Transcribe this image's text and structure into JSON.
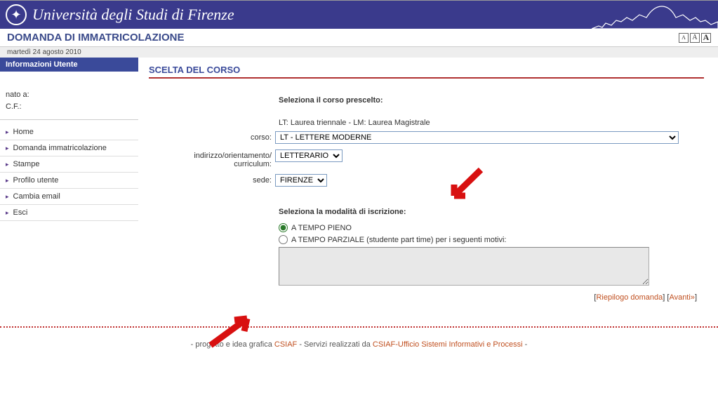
{
  "header": {
    "university": "Università degli Studi di Firenze"
  },
  "page": {
    "title": "DOMANDA DI IMMATRICOLAZIONE",
    "date": "martedì 24 agosto 2010"
  },
  "font_controls": {
    "small": "A",
    "medium": "A",
    "large": "A"
  },
  "sidebar": {
    "header": "Informazioni Utente",
    "nato_label": "nato a:",
    "nato_value": "",
    "cf_label": "C.F.:",
    "cf_value": "",
    "nav": [
      {
        "label": "Home"
      },
      {
        "label": "Domanda immatricolazione"
      },
      {
        "label": "Stampe"
      },
      {
        "label": "Profilo utente"
      },
      {
        "label": "Cambia email"
      },
      {
        "label": "Esci"
      }
    ]
  },
  "main": {
    "section_title": "SCELTA DEL CORSO",
    "select_course_heading": "Seleziona il corso prescelto:",
    "course_legend": "LT: Laurea triennale - LM: Laurea Magistrale",
    "corso_label": "corso:",
    "corso_value": "LT - LETTERE MODERNE",
    "indirizzo_label": "indirizzo/orientamento/ curriculum:",
    "indirizzo_value": "LETTERARIO",
    "sede_label": "sede:",
    "sede_value": "FIRENZE",
    "modalita_heading": "Seleziona la modalità di iscrizione:",
    "radio_fulltime": "A TEMPO PIENO",
    "radio_parttime": "A TEMPO PARZIALE (studente part time) per i seguenti motivi:",
    "link_riepilogo": "Riepilogo domanda",
    "link_avanti": "Avanti»"
  },
  "footer": {
    "prefix": "- progetto e idea grafica ",
    "link1": "CSIAF",
    "middle": " - Servizi realizzati da ",
    "link2": "CSIAF-Ufficio Sistemi Informativi e Processi",
    "suffix": " -"
  }
}
